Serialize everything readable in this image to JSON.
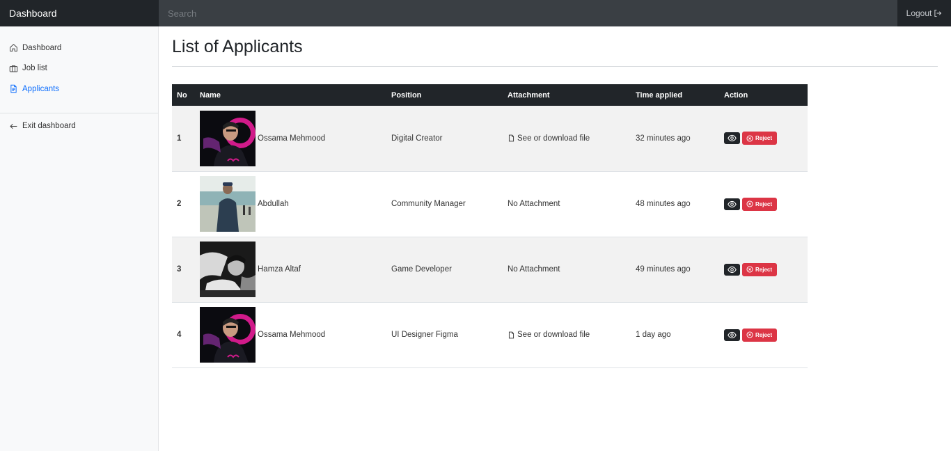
{
  "header": {
    "brand": "Dashboard",
    "search_placeholder": "Search",
    "logout_label": "Logout"
  },
  "sidebar": {
    "items": [
      {
        "label": "Dashboard",
        "icon": "house-icon"
      },
      {
        "label": "Job list",
        "icon": "briefcase-icon"
      },
      {
        "label": "Applicants",
        "icon": "file-text-icon",
        "active": true
      }
    ],
    "exit_label": "Exit dashboard"
  },
  "page": {
    "title": "List of Applicants"
  },
  "table": {
    "headers": [
      "No",
      "Name",
      "Position",
      "Attachment",
      "Time applied",
      "Action"
    ],
    "rows": [
      {
        "no": "1",
        "name": "Ossama Mehmood",
        "position": "Digital Creator",
        "attachment": "See or download file",
        "has_file": true,
        "time": "32 minutes ago"
      },
      {
        "no": "2",
        "name": "Abdullah",
        "position": "Community Manager",
        "attachment": "No Attachment",
        "has_file": false,
        "time": "48 minutes ago"
      },
      {
        "no": "3",
        "name": "Hamza Altaf",
        "position": "Game Developer",
        "attachment": "No Attachment",
        "has_file": false,
        "time": "49 minutes ago"
      },
      {
        "no": "4",
        "name": "Ossama Mehmood",
        "position": "UI Designer Figma",
        "attachment": "See or download file",
        "has_file": true,
        "time": "1 day ago"
      }
    ],
    "reject_label": "Reject"
  },
  "colors": {
    "topbar": "#343a40",
    "dark": "#212529",
    "accent": "#0d6efd",
    "danger": "#dc3545"
  }
}
